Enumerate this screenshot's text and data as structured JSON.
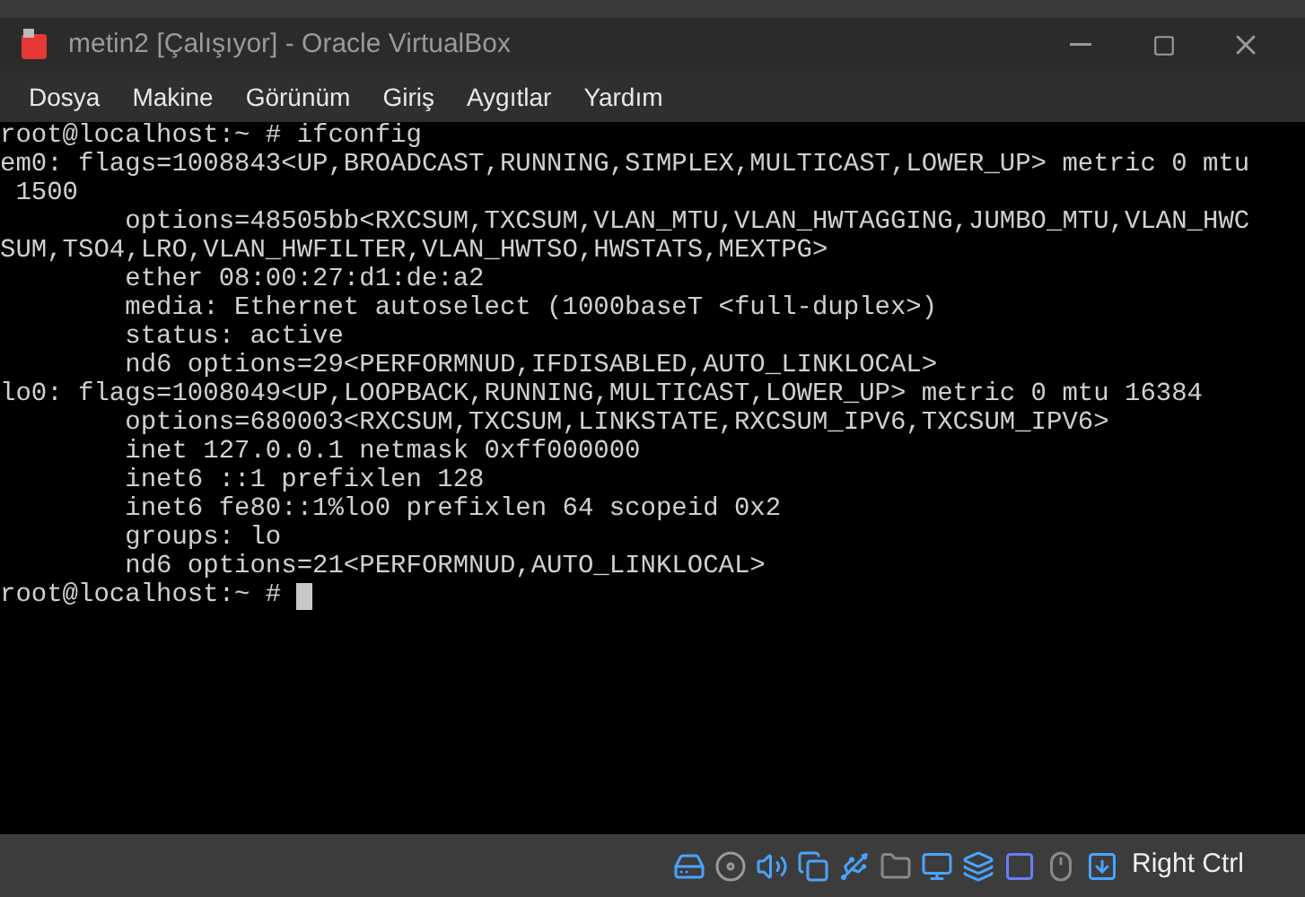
{
  "window": {
    "title": "metin2 [Çalışıyor] - Oracle VirtualBox"
  },
  "menu": [
    "Dosya",
    "Makine",
    "Görünüm",
    "Giriş",
    "Aygıtlar",
    "Yardım"
  ],
  "terminal": {
    "lines": [
      "root@localhost:~ # ifconfig",
      "em0: flags=1008843<UP,BROADCAST,RUNNING,SIMPLEX,MULTICAST,LOWER_UP> metric 0 mtu",
      " 1500",
      "        options=48505bb<RXCSUM,TXCSUM,VLAN_MTU,VLAN_HWTAGGING,JUMBO_MTU,VLAN_HWC",
      "SUM,TSO4,LRO,VLAN_HWFILTER,VLAN_HWTSO,HWSTATS,MEXTPG>",
      "        ether 08:00:27:d1:de:a2",
      "        media: Ethernet autoselect (1000baseT <full-duplex>)",
      "        status: active",
      "        nd6 options=29<PERFORMNUD,IFDISABLED,AUTO_LINKLOCAL>",
      "lo0: flags=1008049<UP,LOOPBACK,RUNNING,MULTICAST,LOWER_UP> metric 0 mtu 16384",
      "        options=680003<RXCSUM,TXCSUM,LINKSTATE,RXCSUM_IPV6,TXCSUM_IPV6>",
      "        inet 127.0.0.1 netmask 0xff000000",
      "        inet6 ::1 prefixlen 128",
      "        inet6 fe80::1%lo0 prefixlen 64 scopeid 0x2",
      "        groups: lo",
      "        nd6 options=21<PERFORMNUD,AUTO_LINKLOCAL>"
    ],
    "prompt": "root@localhost:~ # "
  },
  "status_bar": {
    "host_key": "Right Ctrl"
  }
}
